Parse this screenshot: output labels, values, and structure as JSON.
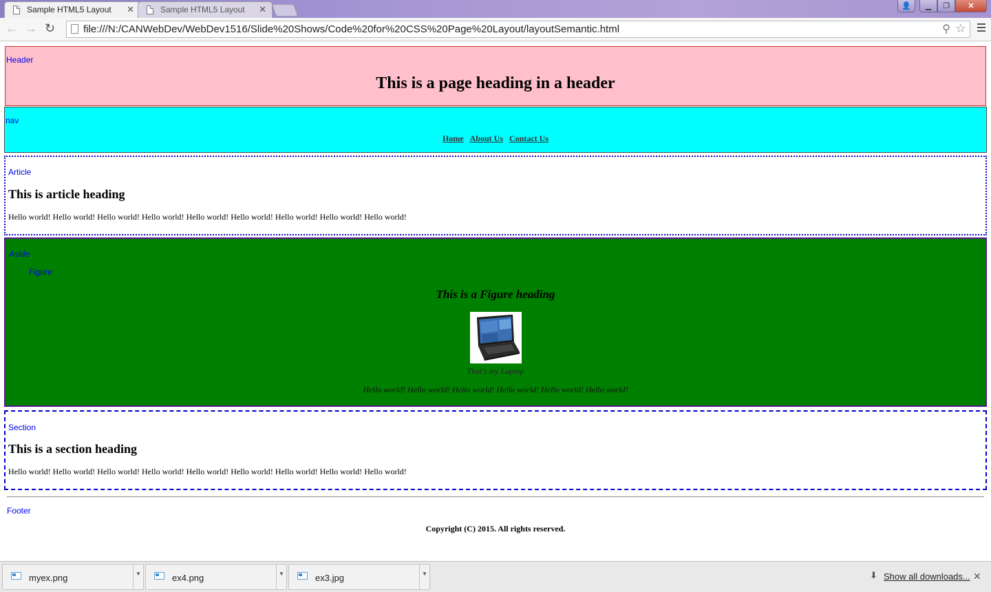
{
  "browser": {
    "tabs": [
      {
        "title": "Sample HTML5 Layout",
        "active": true
      },
      {
        "title": "Sample HTML5 Layout",
        "active": false
      }
    ],
    "url": "file:///N:/CANWebDev/WebDev1516/Slide%20Shows/Code%20for%20CSS%20Page%20Layout/layoutSemantic.html"
  },
  "page": {
    "header": {
      "label": "Header",
      "heading": "This is a page heading in a header"
    },
    "nav": {
      "label": "nav",
      "links": [
        "Home",
        "About Us",
        "Contact Us"
      ]
    },
    "article": {
      "label": "Article",
      "heading": "This is article heading",
      "text": "Hello world! Hello world! Hello world! Hello world! Hello world! Hello world! Hello world! Hello world! Hello world!"
    },
    "aside": {
      "label": "Aside",
      "figure_label": "Figure",
      "figure_heading": "This is a Figure heading",
      "caption": "That's my Laptop",
      "text": "Hello world! Hello world! Hello world! Hello world! Hello world! Hello world!"
    },
    "section": {
      "label": "Section",
      "heading": "This is a section heading",
      "text": "Hello world! Hello world! Hello world! Hello world! Hello world! Hello world! Hello world! Hello world! Hello world!"
    },
    "footer": {
      "label": "Footer",
      "copyright": "Copyright (C) 2015. All rights reserved."
    }
  },
  "downloads": {
    "items": [
      "myex.png",
      "ex4.png",
      "ex3.jpg"
    ],
    "show_all": "Show all downloads..."
  },
  "colors": {
    "header_bg": "#ffc0cb",
    "nav_bg": "#00ffff",
    "aside_bg": "#008000",
    "label_color": "#0000ee"
  },
  "icons": [
    "page-icon",
    "back-arrow-icon",
    "forward-arrow-icon",
    "reload-icon",
    "search-icon",
    "bookmark-star-icon",
    "menu-icon",
    "image-file-icon",
    "download-icon",
    "close-icon"
  ]
}
